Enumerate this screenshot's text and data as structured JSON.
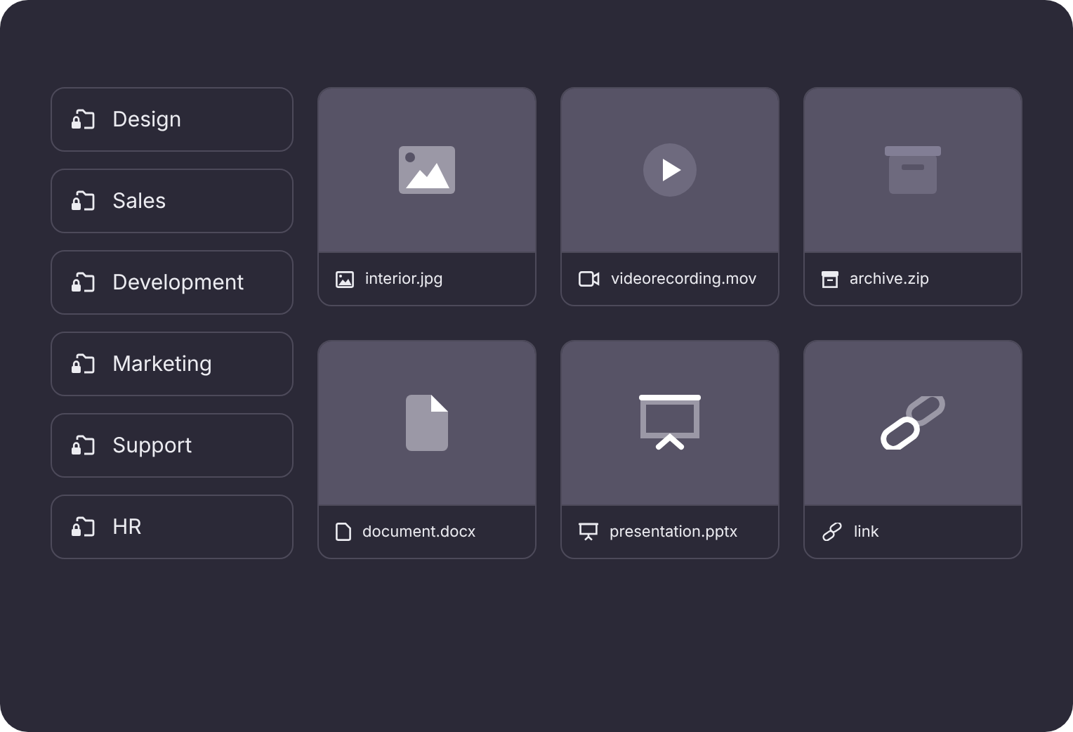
{
  "folders": [
    {
      "name": "Design"
    },
    {
      "name": "Sales"
    },
    {
      "name": "Development"
    },
    {
      "name": "Marketing"
    },
    {
      "name": "Support"
    },
    {
      "name": "HR"
    }
  ],
  "files": [
    {
      "name": "interior.jpg",
      "kind": "image"
    },
    {
      "name": "videorecording.mov",
      "kind": "video"
    },
    {
      "name": "archive.zip",
      "kind": "archive"
    },
    {
      "name": "document.docx",
      "kind": "document"
    },
    {
      "name": "presentation.pptx",
      "kind": "presentation"
    },
    {
      "name": "link",
      "kind": "link"
    }
  ]
}
